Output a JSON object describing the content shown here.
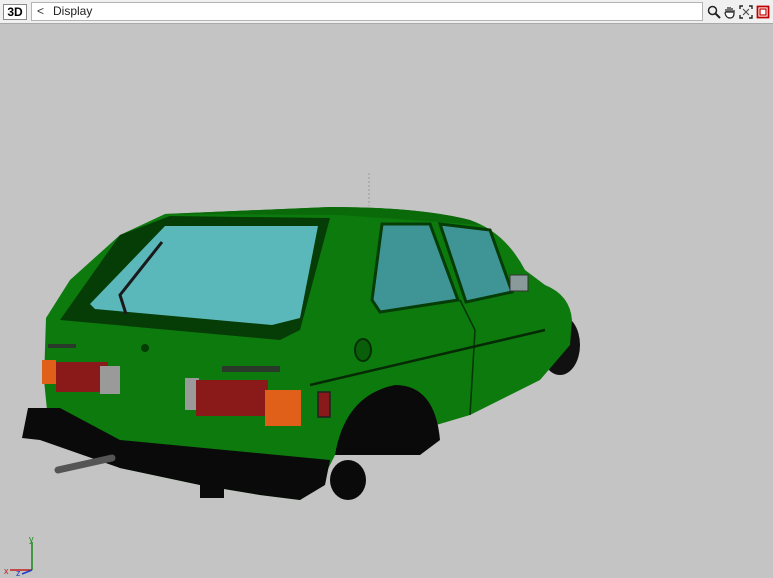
{
  "toolbar": {
    "mode_label": "3D",
    "back_symbol": "<",
    "title": "Display",
    "tools": [
      {
        "name": "zoom-icon"
      },
      {
        "name": "pan-hand-icon"
      },
      {
        "name": "fit-view-icon"
      },
      {
        "name": "close-view-icon"
      }
    ]
  },
  "viewport": {
    "model_name": "green-hatchback-car",
    "body_color": "#0c7d0c",
    "glass_color": "#5ab8ba",
    "background_color": "#c4c4c4"
  },
  "axis_triad": {
    "x_label": "x",
    "y_label": "y",
    "z_label": "z"
  }
}
